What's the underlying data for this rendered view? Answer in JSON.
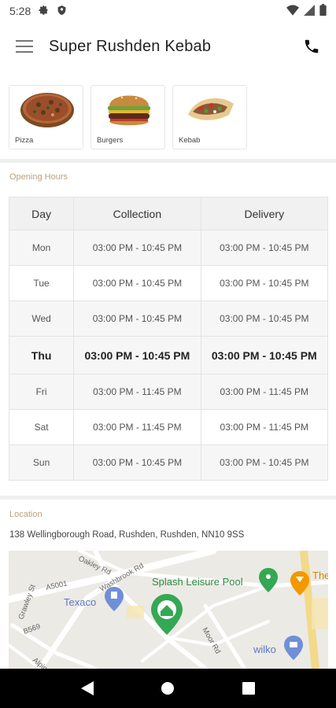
{
  "status_bar": {
    "time": "5:28",
    "icons": [
      "gear-icon",
      "shield-icon",
      "wifi-icon",
      "signal-icon",
      "battery-icon"
    ]
  },
  "app_bar": {
    "title": "Super Rushden Kebab",
    "icons": [
      "hamburger-menu-icon",
      "phone-icon"
    ]
  },
  "categories": [
    {
      "label": "Pizza"
    },
    {
      "label": "Burgers"
    },
    {
      "label": "Kebab"
    }
  ],
  "opening_hours": {
    "section_title": "Opening Hours",
    "headers": [
      "Day",
      "Collection",
      "Delivery"
    ],
    "rows": [
      {
        "day": "Mon",
        "collection": "03:00 PM - 10:45 PM",
        "delivery": "03:00 PM - 10:45 PM"
      },
      {
        "day": "Tue",
        "collection": "03:00 PM - 10:45 PM",
        "delivery": "03:00 PM - 10:45 PM"
      },
      {
        "day": "Wed",
        "collection": "03:00 PM - 10:45 PM",
        "delivery": "03:00 PM - 10:45 PM"
      },
      {
        "day": "Thu",
        "collection": "03:00 PM - 10:45 PM",
        "delivery": "03:00 PM - 10:45 PM"
      },
      {
        "day": "Fri",
        "collection": "03:00 PM - 11:45 PM",
        "delivery": "03:00 PM - 11:45 PM"
      },
      {
        "day": "Sat",
        "collection": "03:00 PM - 11:45 PM",
        "delivery": "03:00 PM - 11:45 PM"
      },
      {
        "day": "Sun",
        "collection": "03:00 PM - 10:45 PM",
        "delivery": "03:00 PM - 10:45 PM"
      }
    ],
    "highlighted_day": "Thu"
  },
  "location": {
    "section_title": "Location",
    "address": "138 Wellingborough Road, Rushden, Rushden, NN10 9SS",
    "map_labels": {
      "oakley": "Oakley Rd",
      "washbrook": "Washbrook Rd",
      "a5001": "A5001",
      "grawley": "Grawley St",
      "b569": "B569",
      "alpine": "Alpine Rd",
      "moor": "Moor Rd",
      "texaco": "Texaco",
      "splash": "Splash Leisure Pool",
      "jd": "The JD",
      "wilko": "wilko"
    }
  },
  "nav_bar": {
    "icons": [
      "back-icon",
      "home-icon",
      "recents-icon"
    ]
  },
  "colors": {
    "section_label": "#b8a27a",
    "map_green": "#34a853",
    "map_blue": "#6f8fd8"
  }
}
